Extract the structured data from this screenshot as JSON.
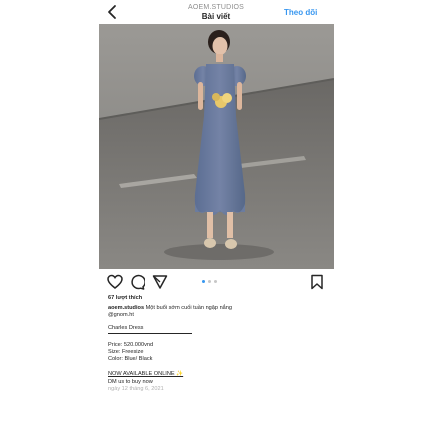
{
  "header": {
    "account": "AOEM.STUDIOS",
    "title": "Bài viết",
    "follow_label": "Theo dõi",
    "back_icon": "chevron-left-icon"
  },
  "post": {
    "actions": [
      "heart-icon",
      "comment-icon",
      "share-icon",
      "bookmark-icon"
    ],
    "carousel": {
      "count": 3,
      "active": 1
    },
    "likes": "67 lượt thích",
    "caption_user": "aoem.studios",
    "caption_text": "Một buổi sớm cuối tuần ngập nắng",
    "mention": "@gnom.ht",
    "product_name": "Charles Dress",
    "price": "Price: 520.000vnd",
    "size": "Size: Freesize",
    "color": "Color: Blue/ Black",
    "availability": "NOW AVAILABLE ONLINE ✨",
    "dm": "DM us to buy now",
    "date": "ngày 12 tháng 6, 2021"
  },
  "colors": {
    "link": "#3897f0",
    "text": "#262626",
    "muted": "#8e8e8e"
  }
}
